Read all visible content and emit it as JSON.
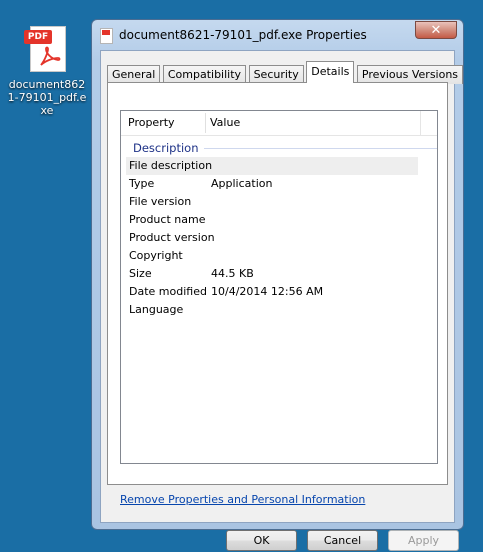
{
  "desktop": {
    "icon_badge": "PDF",
    "icon_label": "document8621-79101_pdf.exe",
    "icon_name": "pdf-file-icon"
  },
  "window": {
    "title": "document8621-79101_pdf.exe Properties",
    "close_glyph": "✕",
    "tabs": [
      "General",
      "Compatibility",
      "Security",
      "Details",
      "Previous Versions"
    ],
    "active_tab": "Details"
  },
  "details": {
    "columns": [
      "Property",
      "Value"
    ],
    "group": "Description",
    "rows": [
      {
        "property": "File description",
        "value": ""
      },
      {
        "property": "Type",
        "value": "Application"
      },
      {
        "property": "File version",
        "value": ""
      },
      {
        "property": "Product name",
        "value": ""
      },
      {
        "property": "Product version",
        "value": ""
      },
      {
        "property": "Copyright",
        "value": ""
      },
      {
        "property": "Size",
        "value": "44.5 KB"
      },
      {
        "property": "Date modified",
        "value": "10/4/2014 12:56 AM"
      },
      {
        "property": "Language",
        "value": ""
      }
    ]
  },
  "remove_link": "Remove Properties and Personal Information",
  "buttons": {
    "ok": "OK",
    "cancel": "Cancel",
    "apply": "Apply"
  },
  "colors": {
    "desktop": "#1a6ea5",
    "link": "#0645ad",
    "group_heading": "#1e3287",
    "pdf_red": "#e4342a"
  }
}
